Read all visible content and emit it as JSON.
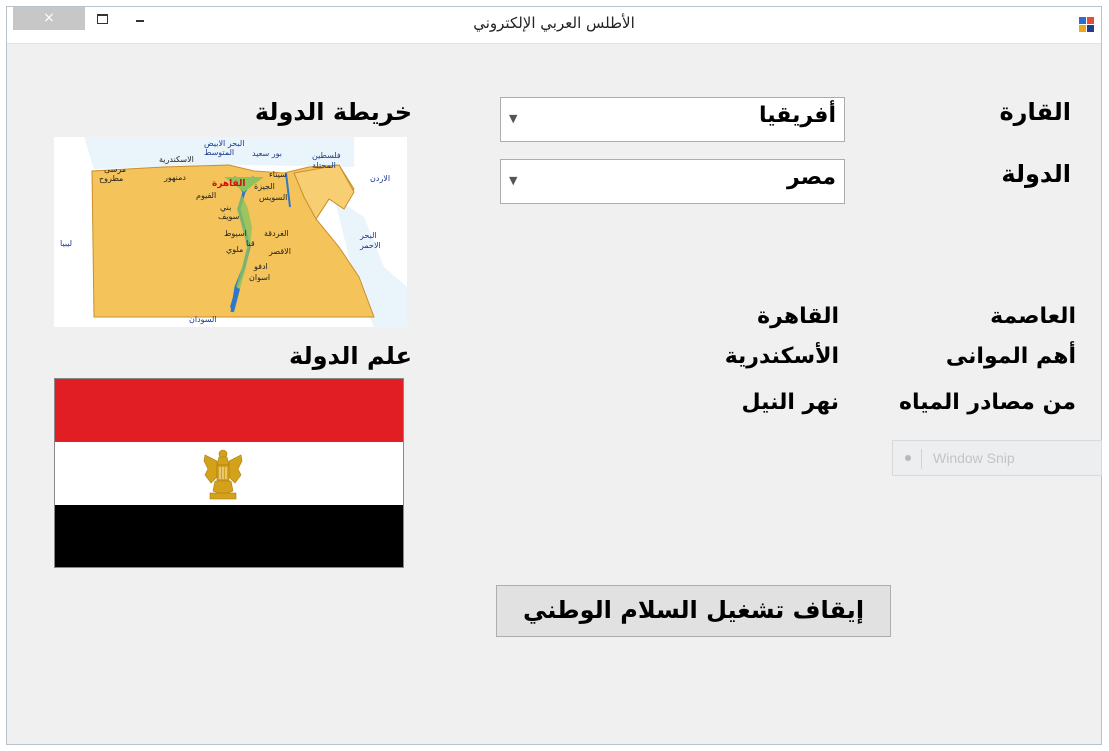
{
  "window": {
    "title": "الأطلس العربي الإلكتروني",
    "close_glyph": "×"
  },
  "form": {
    "continent_label": "القارة",
    "continent_value": "أفريقيا",
    "country_label": "الدولة",
    "country_value": "مصر",
    "capital_label": "العاصمة",
    "capital_value": "القاهرة",
    "ports_label": "أهم الموانى",
    "ports_value": "الأسكندرية",
    "water_label": "من مصادر المياه",
    "water_value": "نهر النيل",
    "map_label": "خريطة الدولة",
    "flag_label": "علم الدولة",
    "anthem_button": "إيقاف تشغيل السلام الوطني"
  },
  "map": {
    "labels": [
      "البحر الابيض",
      "المتوسط",
      "بور سعيد",
      "فلسطين",
      "المحتلة",
      "الاسكندرية",
      "مرسى",
      "مطروح",
      "دمنهور",
      "القاهرة",
      "سيناء",
      "الجيزة",
      "الفيوم",
      "السويس",
      "بني",
      "سويف",
      "الاردن",
      "البحر",
      "الاحمر",
      "اسيوط",
      "الغردقة",
      "قنا",
      "ملوي",
      "الاقصر",
      "ادفو",
      "اسوان",
      "ليبيا",
      "السودان"
    ]
  },
  "overlay": {
    "snip_text": "Window Snip"
  },
  "colors": {
    "flag_red": "#e01e24",
    "flag_white": "#ffffff",
    "flag_black": "#000000",
    "eagle_gold": "#d4a21a",
    "map_land": "#f4c35a"
  }
}
